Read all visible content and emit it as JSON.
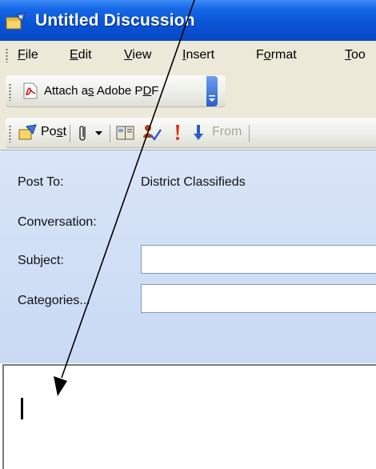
{
  "window": {
    "title": "Untitled Discussion"
  },
  "menu": {
    "items": [
      {
        "label": "File",
        "key": "F",
        "rest": "ile"
      },
      {
        "label": "Edit",
        "key": "E",
        "rest": "dit"
      },
      {
        "label": "View",
        "key": "V",
        "rest": "iew"
      },
      {
        "label": "Insert",
        "key": "I",
        "rest": "nsert"
      },
      {
        "label": "Format",
        "pre": "F",
        "key": "o",
        "rest": "rmat"
      },
      {
        "label": "Too",
        "key": "T",
        "rest": "oo"
      }
    ]
  },
  "pdf_toolbar": {
    "label_pre": "Attach a",
    "label_key": "s",
    "label_post": " Adobe P",
    "label_key2": "D",
    "label_end": "F"
  },
  "standard_toolbar": {
    "post_pre": "Po",
    "post_key": "s",
    "post_end": "t",
    "from_label": "From"
  },
  "header": {
    "post_to_label": "Post To:",
    "post_to_value": "District Classifieds",
    "conversation_label": "Conversation:",
    "subject_label": "Subject:",
    "subject_value": "",
    "categories_label": "Categories...",
    "categories_value": ""
  },
  "colors": {
    "title_bar": "#0a55d6",
    "menu_bg": "#ece9d8",
    "header_bg": "#c9daf4",
    "annotation_arrow": "#000000"
  },
  "icons": {
    "title": "discussion-post-icon",
    "pdf": "adobe-pdf-icon",
    "post": "post-icon",
    "attach": "paperclip-icon",
    "address_book": "address-book-icon",
    "check_names": "check-names-icon",
    "importance_high": "exclamation-icon",
    "importance_low": "down-arrow-icon"
  }
}
